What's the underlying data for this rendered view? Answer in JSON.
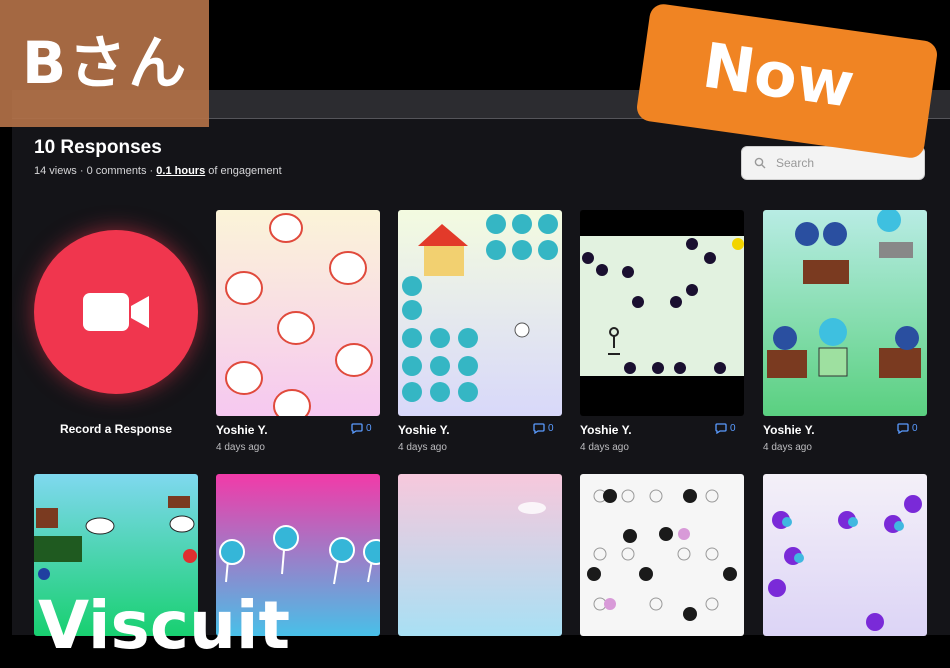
{
  "overlays": {
    "user_tag": "Bさん",
    "status_tag": "Now",
    "app_name": "Viscuit"
  },
  "header": {
    "title": "10 Responses",
    "views": "14 views",
    "sep1": " · ",
    "comments": "0 comments",
    "sep2": " · ",
    "hours": "0.1 hours",
    "engagement": " of engagement"
  },
  "search": {
    "placeholder": "Search",
    "value": ""
  },
  "record": {
    "label": "Record a Response"
  },
  "responses": [
    {
      "author": "Yoshie Y.",
      "time": "4 days ago",
      "comments": "0"
    },
    {
      "author": "Yoshie Y.",
      "time": "4 days ago",
      "comments": "0"
    },
    {
      "author": "Yoshie Y.",
      "time": "4 days ago",
      "comments": "0"
    },
    {
      "author": "Yoshie Y.",
      "time": "4 days ago",
      "comments": "0"
    }
  ],
  "colors": {
    "record": "#f0364e",
    "accent": "#5a9bff",
    "user_tag_bg": "#b27148",
    "status_tag_bg": "#f08423"
  }
}
